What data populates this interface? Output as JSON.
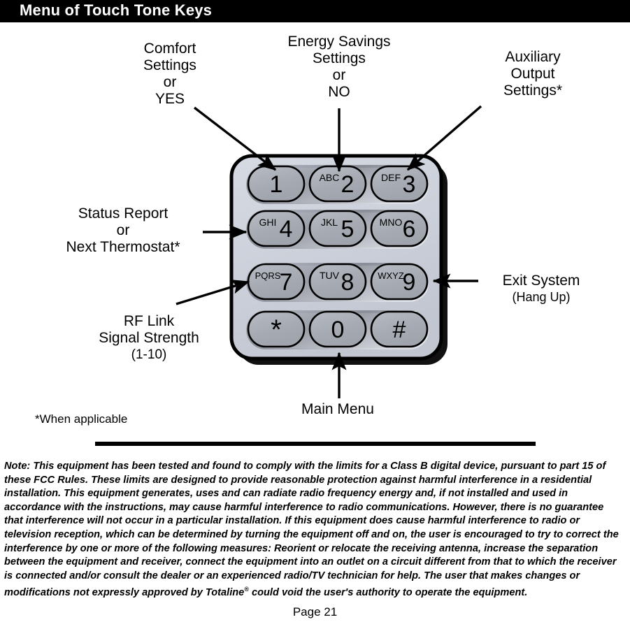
{
  "header": {
    "title": "Menu of Touch Tone Keys"
  },
  "callouts": {
    "comfort": "Comfort\nSettings\nor\nYES",
    "energy": "Energy Savings\nSettings\nor\nNO",
    "auxiliary": "Auxiliary\nOutput\nSettings*",
    "status": "Status Report\nor\nNext Thermostat*",
    "rf_main": "RF Link\nSignal Strength",
    "rf_sub": "(1-10)",
    "exit_main": "Exit System",
    "exit_sub": "(Hang Up)",
    "main_menu": "Main Menu"
  },
  "footnote": "*When applicable",
  "keypad": {
    "keys": [
      {
        "digit": "1",
        "letters": ""
      },
      {
        "digit": "2",
        "letters": "ABC"
      },
      {
        "digit": "3",
        "letters": "DEF"
      },
      {
        "digit": "4",
        "letters": "GHI"
      },
      {
        "digit": "5",
        "letters": "JKL"
      },
      {
        "digit": "6",
        "letters": "MNO"
      },
      {
        "digit": "7",
        "letters": "PQRS"
      },
      {
        "digit": "8",
        "letters": "TUV"
      },
      {
        "digit": "9",
        "letters": "WXYZ"
      },
      {
        "digit": "*",
        "letters": ""
      },
      {
        "digit": "0",
        "letters": ""
      },
      {
        "digit": "#",
        "letters": ""
      }
    ],
    "colors": {
      "body": "#ced2dc",
      "key": "#a8acb4",
      "trough_dark": "#8d919b",
      "outline": "#000000"
    }
  },
  "fcc_note": "Note:  This equipment has been tested and found to comply with the limits for a Class B digital device, pursuant to part 15 of these FCC Rules.  These limits are designed to provide reasonable protection against harmful interference in a residential installation. This equipment generates, uses and can radiate radio frequency energy and, if not installed and used in accordance with the instructions, may cause harmful interference to radio communications.  However, there is no guarantee that interference will not occur in a particular installation.  If this equipment does cause harmful interference to radio or television reception, which can be determined by turning the equipment off and on, the user is encouraged to try to correct the interference by one or more of the following measures: Reorient or relocate the receiving antenna, increase the separation between the equipment and receiver, connect the equipment into an outlet on a circuit different from that to which the receiver is connected and/or consult the dealer or an experienced radio/TV technician for help.  The user that makes changes or modifications not expressly approved by Totaline",
  "fcc_note_sup": "®",
  "fcc_note_tail": " could void the user's authority to operate the equipment.",
  "page_footer": "Page 21"
}
